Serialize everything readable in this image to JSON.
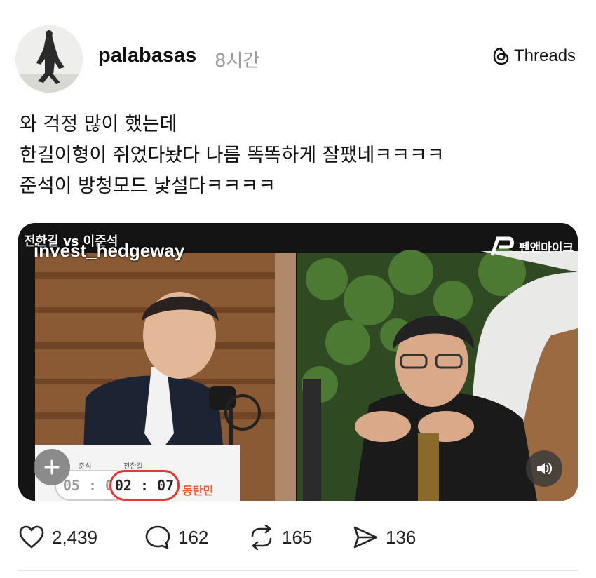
{
  "post": {
    "username": "palabasas",
    "time": "8시간",
    "platform": "Threads",
    "lines": [
      "와 걱정 많이 했는데",
      "한길이형이 쥐었다놨다 나름 똑똑하게 잘팼네ㅋㅋㅋㅋ",
      "준석이 방청모드 낯설다ㅋㅋㅋㅋ"
    ]
  },
  "video": {
    "watermark": "invest_hedgeway",
    "show_title": "전한길 vs 이준석",
    "brand": "펜앤마이크",
    "timer_left": "05 : 00",
    "timer_right": "02 : 07",
    "name_tag": "동탄민",
    "speaker_left": "준석",
    "speaker_right": "전한길"
  },
  "actions": {
    "likes": "2,439",
    "comments": "162",
    "reposts": "165",
    "shares": "136"
  },
  "colors": {
    "text": "#111111",
    "muted": "#9b9b9b",
    "wood": "#8a5a34",
    "plants": "#3f6b2b"
  }
}
